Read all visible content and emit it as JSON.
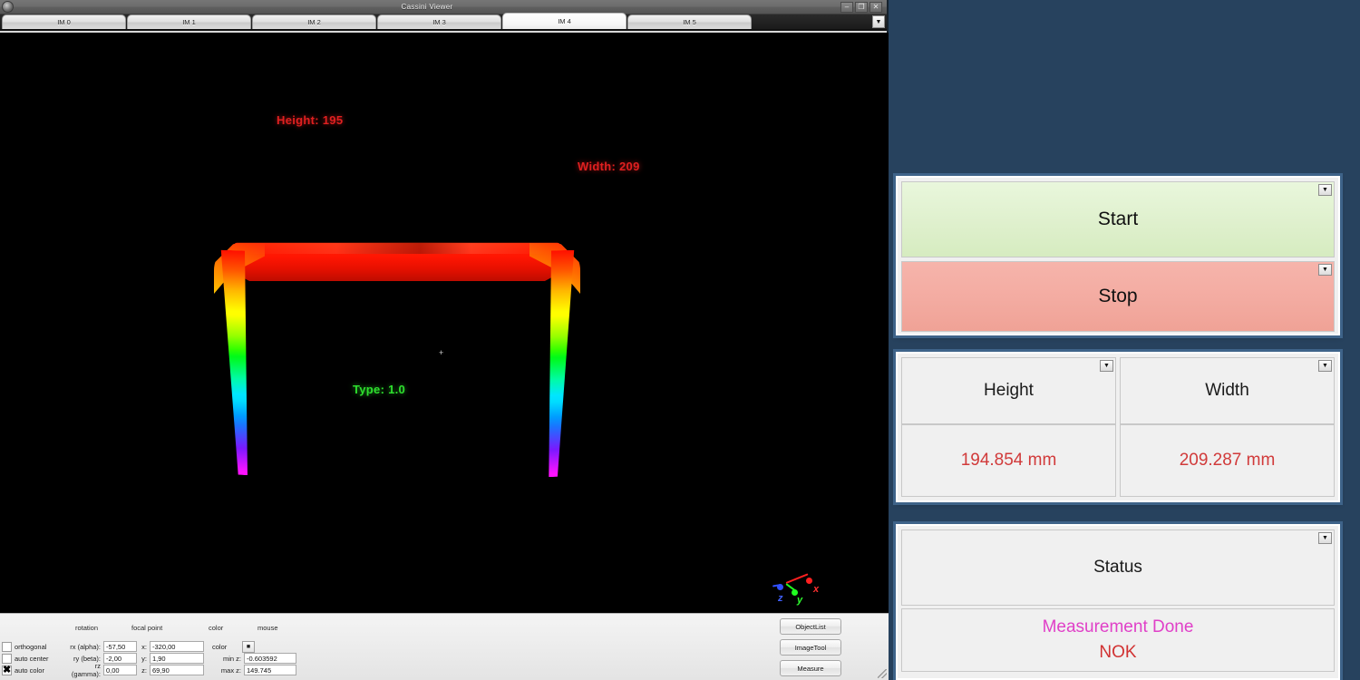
{
  "window": {
    "title": "Cassini Viewer",
    "controls": {
      "minimize": "–",
      "maximize": "❐",
      "close": "✕"
    },
    "app_icon": "app-logo-icon"
  },
  "tabs": {
    "items": [
      {
        "label": "IM 0",
        "active": false
      },
      {
        "label": "IM 1",
        "active": false
      },
      {
        "label": "IM 2",
        "active": false
      },
      {
        "label": "IM 3",
        "active": false
      },
      {
        "label": "IM 4",
        "active": true
      },
      {
        "label": "IM 5",
        "active": false
      }
    ],
    "overflow_glyph": "▼"
  },
  "viewport": {
    "background": "#000000",
    "overlays": {
      "height": {
        "text": "Height: 195",
        "color": "#e02020"
      },
      "width": {
        "text": "Width: 209",
        "color": "#e02020"
      },
      "type": {
        "text": "Type: 1.0",
        "color": "#2ee02e"
      }
    },
    "focal_marker": "+",
    "axes": [
      {
        "label": "x",
        "color": "#ff2020"
      },
      {
        "label": "y",
        "color": "#20ff20"
      },
      {
        "label": "z",
        "color": "#3050ff"
      }
    ]
  },
  "controls": {
    "headers": {
      "rotation": "rotation",
      "focal_point": "focal point",
      "color": "color",
      "mouse": "mouse"
    },
    "checkboxes": [
      {
        "label": "orthogonal",
        "checked": false
      },
      {
        "label": "auto center",
        "checked": false
      },
      {
        "label": "auto color",
        "checked": true
      }
    ],
    "rotation": [
      {
        "label": "rx (alpha):",
        "value": "-57,50"
      },
      {
        "label": "ry (beta):",
        "value": "-2,00"
      },
      {
        "label": "rz (gamma):",
        "value": "0,00"
      }
    ],
    "focal_point": [
      {
        "label": "x:",
        "value": "-320,00"
      },
      {
        "label": "y:",
        "value": "1,90"
      },
      {
        "label": "z:",
        "value": "69,90"
      }
    ],
    "color": {
      "mode_label": "color",
      "mode_glyph": "■",
      "min_z_label": "min z:",
      "min_z_value": "-0.603592",
      "max_z_label": "max z:",
      "max_z_value": "149.745"
    },
    "buttons": [
      {
        "label": "ObjectList"
      },
      {
        "label": "ImageTool"
      },
      {
        "label": "Measure"
      }
    ]
  },
  "hmi": {
    "background": "#27425e",
    "combo_glyph": "▼",
    "controls_group": {
      "start": {
        "label": "Start",
        "color": "#dff0cd"
      },
      "stop": {
        "label": "Stop",
        "color": "#f3aba1"
      }
    },
    "measure_group": {
      "height": {
        "title": "Height",
        "value": "194.854 mm",
        "value_color": "#d13a3a"
      },
      "width": {
        "title": "Width",
        "value": "209.287 mm",
        "value_color": "#d13a3a"
      }
    },
    "status_group": {
      "title": "Status",
      "message": {
        "text": "Measurement Done",
        "color": "#e040c8"
      },
      "result": {
        "text": "NOK",
        "color": "#d13232"
      }
    }
  }
}
